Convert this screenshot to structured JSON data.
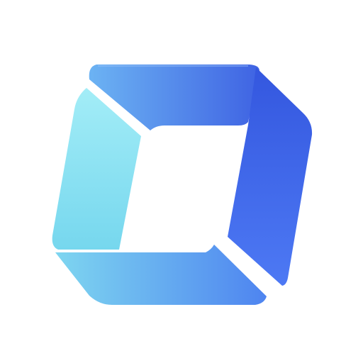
{
  "logo": {
    "icon": "frame-cube-logo-icon",
    "background": "#ffffff",
    "colors": {
      "top_start": "#6CB3F3",
      "top_end": "#3F63E3",
      "right_start": "#3457DF",
      "right_end": "#4D79F4",
      "bottom_start": "#7ED6F0",
      "bottom_end": "#4E84F0",
      "left_start": "#A3EDF7",
      "left_end": "#76D7EE"
    }
  }
}
